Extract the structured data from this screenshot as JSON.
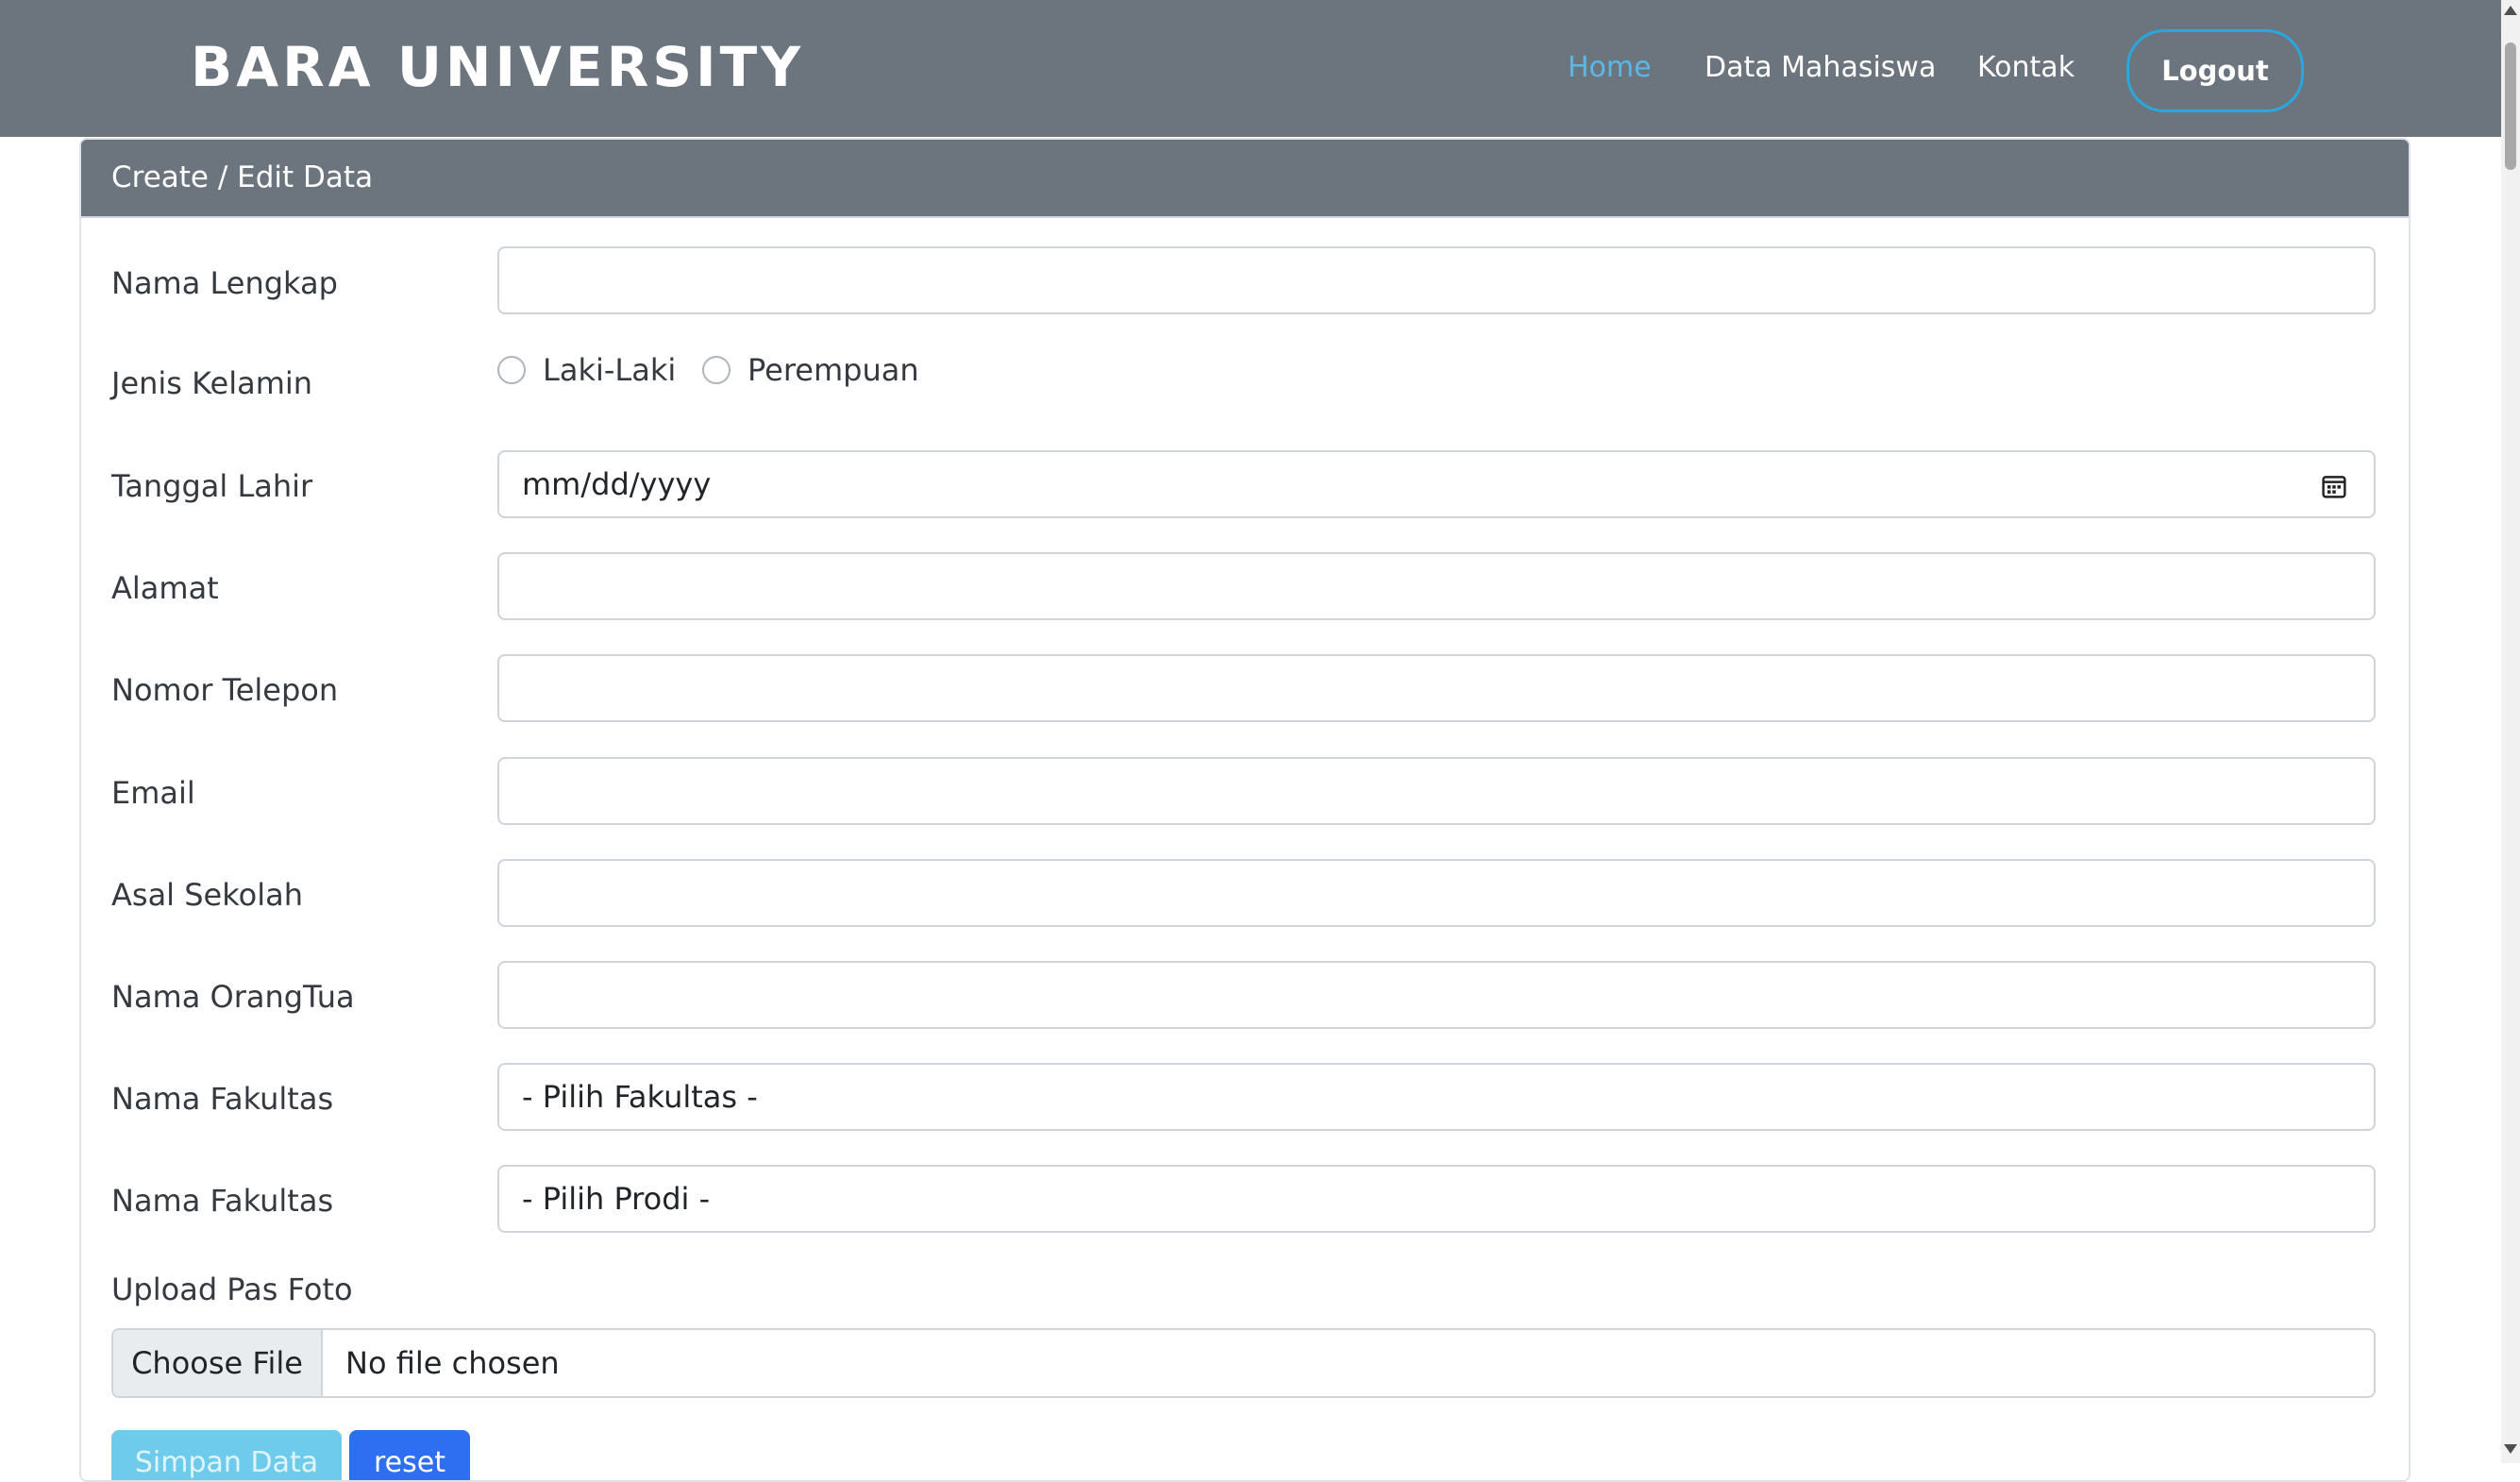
{
  "navbar": {
    "brand": "BARA UNIVERSITY",
    "links": [
      {
        "label": "Home",
        "active": true
      },
      {
        "label": "Data Mahasiswa",
        "active": false
      },
      {
        "label": "Kontak",
        "active": false
      }
    ],
    "logout_label": "Logout"
  },
  "card": {
    "title": "Create / Edit Data"
  },
  "form": {
    "nama_lengkap": {
      "label": "Nama Lengkap",
      "value": ""
    },
    "jenis_kelamin": {
      "label": "Jenis Kelamin",
      "options": [
        "Laki-Laki",
        "Perempuan"
      ]
    },
    "tanggal_lahir": {
      "label": "Tanggal Lahir",
      "placeholder": "mm/dd/yyyy"
    },
    "alamat": {
      "label": "Alamat",
      "value": ""
    },
    "nomor_telepon": {
      "label": "Nomor Telepon",
      "value": ""
    },
    "email": {
      "label": "Email",
      "value": ""
    },
    "asal_sekolah": {
      "label": "Asal Sekolah",
      "value": ""
    },
    "nama_orangtua": {
      "label": "Nama OrangTua",
      "value": ""
    },
    "fakultas": {
      "label": "Nama Fakultas",
      "selected": "- Pilih Fakultas -"
    },
    "prodi": {
      "label": "Nama Fakultas",
      "selected": "- Pilih Prodi -"
    },
    "upload": {
      "label": "Upload Pas Foto",
      "button_label": "Choose File",
      "status": "No file chosen"
    },
    "buttons": {
      "save_label": "Simpan Data",
      "reset_label": "reset"
    }
  },
  "icons": {
    "date_picker": "calendar-icon"
  },
  "colors": {
    "navbar_bg": "#6c757d",
    "active_link": "#5bb8e6",
    "logout_border": "#29a8e0",
    "save_button": "#6ecbeb",
    "reset_button": "#2d6ff0"
  }
}
